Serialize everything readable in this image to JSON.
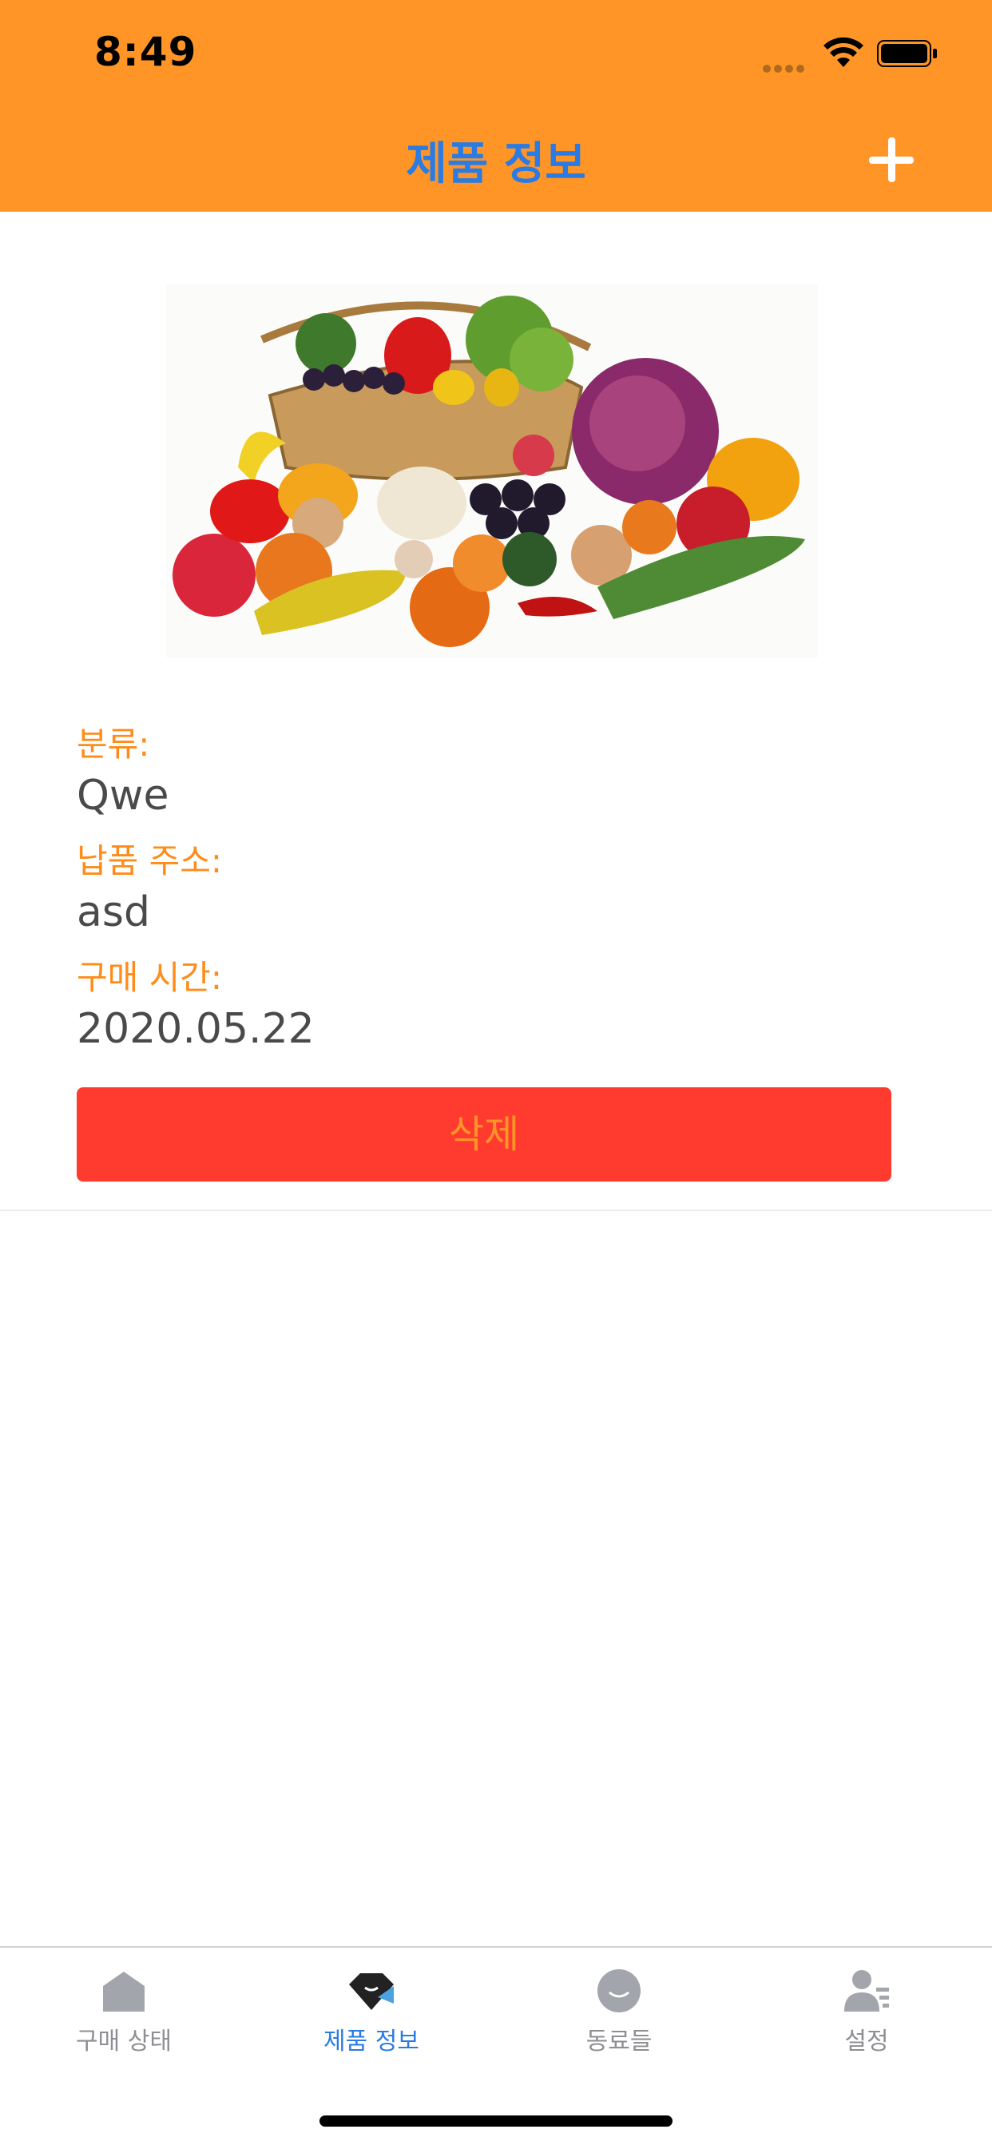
{
  "status_bar": {
    "time": "8:49"
  },
  "nav": {
    "title": "제품 정보",
    "add_icon": "plus-icon"
  },
  "product": {
    "image_icon": "vegetable-basket-photo",
    "category_label": "분류:",
    "category_value": "Qwe",
    "address_label": "납품 주소:",
    "address_value": "asd",
    "purchase_time_label": "구매 시간:",
    "purchase_time_value": "2020.05.22",
    "delete_label": "삭제"
  },
  "tab_bar": {
    "items": [
      {
        "label": "구매 상태",
        "icon": "house-icon",
        "active": false
      },
      {
        "label": "제품 정보",
        "icon": "diamond-face-icon",
        "active": true
      },
      {
        "label": "동료들",
        "icon": "smiley-icon",
        "active": false
      },
      {
        "label": "설정",
        "icon": "person-settings-icon",
        "active": false
      }
    ]
  },
  "colors": {
    "header_bg": "#ff9526",
    "accent_blue": "#2a7be4",
    "label_orange": "#ff8c1a",
    "delete_red": "#ff3b30",
    "tab_inactive": "#8e8e93"
  }
}
